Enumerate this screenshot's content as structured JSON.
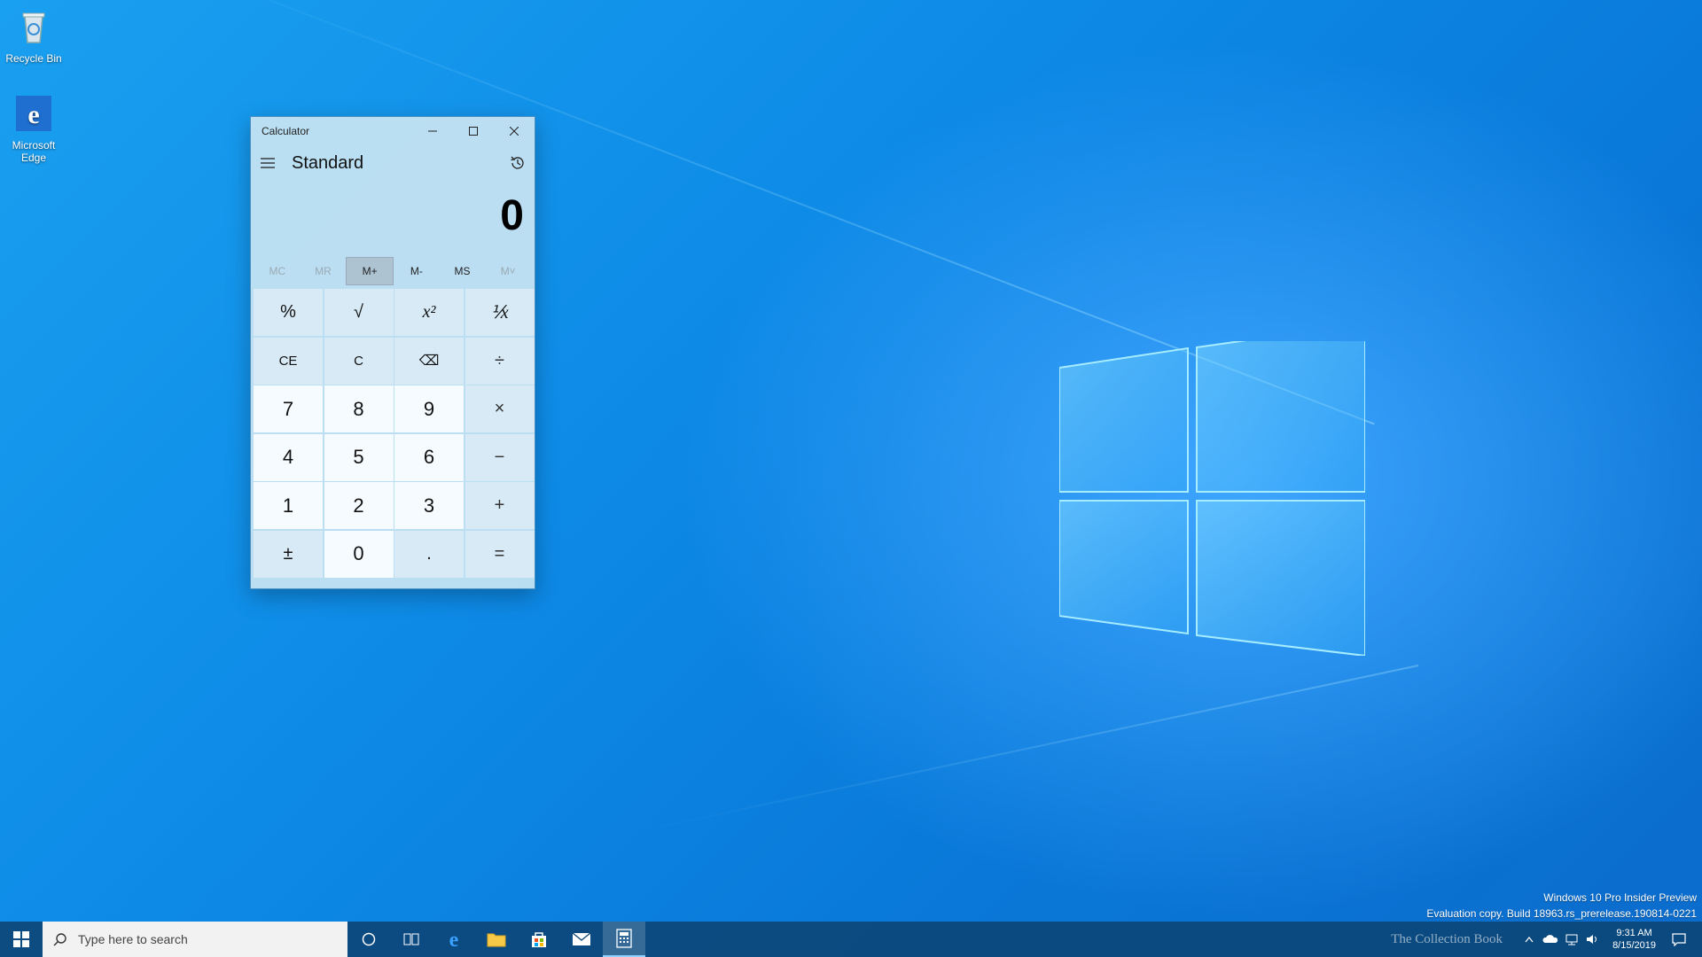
{
  "desktop": {
    "icons": [
      {
        "label": "Recycle Bin",
        "icon": "recycle-bin-icon"
      },
      {
        "label": "Microsoft Edge",
        "icon": "edge-icon"
      }
    ]
  },
  "calculator": {
    "window_title": "Calculator",
    "mode": "Standard",
    "display_value": "0",
    "memory_buttons": [
      "MC",
      "MR",
      "M+",
      "M-",
      "MS",
      "M˅"
    ],
    "keys": {
      "percent": "%",
      "sqrt": "√",
      "square": "x²",
      "reciprocal": "⅟x",
      "ce": "CE",
      "c": "C",
      "backspace": "⌫",
      "divide": "÷",
      "seven": "7",
      "eight": "8",
      "nine": "9",
      "multiply": "×",
      "four": "4",
      "five": "5",
      "six": "6",
      "minus": "−",
      "one": "1",
      "two": "2",
      "three": "3",
      "plus": "+",
      "negate": "±",
      "zero": "0",
      "decimal": ".",
      "equals": "="
    }
  },
  "watermark": {
    "line1": "Windows 10 Pro Insider Preview",
    "line2": "Evaluation copy. Build 18963.rs_prerelease.190814-0221"
  },
  "taskbar": {
    "search_placeholder": "Type here to search",
    "time": "9:31 AM",
    "date": "8/15/2019",
    "overlay_text": "The Collection Book"
  },
  "colors": {
    "desktop_blue": "#0d8ae6",
    "taskbar": "#0c4678",
    "accent": "#4a90c0"
  }
}
